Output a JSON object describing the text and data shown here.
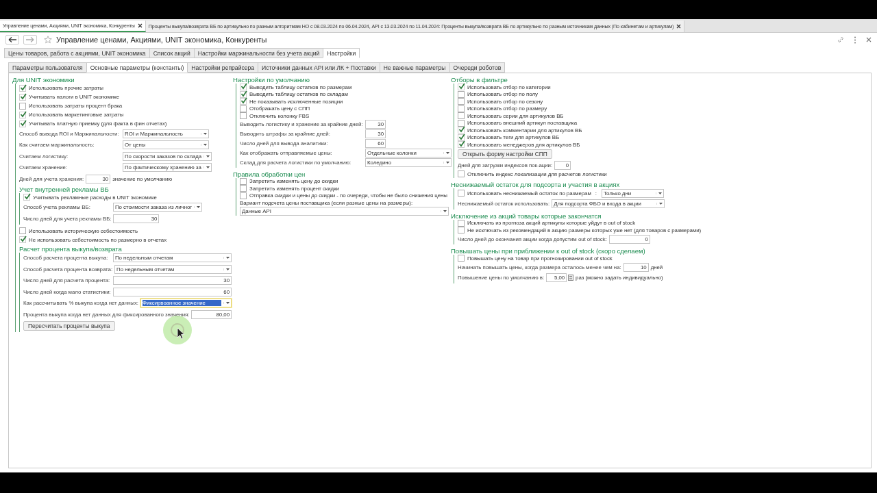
{
  "browser_tabs": [
    {
      "title": "Управление ценами, Акциями, UNIT экономика, Конкуренты",
      "selected": true
    },
    {
      "title": "Проценты выкупа/возврата ВБ по артикульно по разным алгоритмам НО с 08.03.2024 по 06.04.2024, API с 13.03.2024 по 11.04.2024: Проценты выкупа/возврата ВБ по артикульно по разным источникам данных (По кабинетам и артикулам)",
      "selected": false
    }
  ],
  "window": {
    "title": "Управление ценами, Акциями, UNIT экономика, Конкуренты"
  },
  "tabs": [
    {
      "label": "Цены товаров, работа с акциями, UNIT экономика",
      "selected": false
    },
    {
      "label": "Список акций",
      "selected": false
    },
    {
      "label": "Настройки маржинальности без учета акций",
      "selected": false
    },
    {
      "label": "Настройки",
      "selected": true
    }
  ],
  "subtabs": [
    {
      "label": "Параметры пользователя",
      "selected": false
    },
    {
      "label": "Основные параметры (константы)",
      "selected": true
    },
    {
      "label": "Настройки репрайсера",
      "selected": false
    },
    {
      "label": "Источники данных API или ЛК + Поставки",
      "selected": false
    },
    {
      "label": "Не важные параметры",
      "selected": false
    },
    {
      "label": "Очереди роботов",
      "selected": false
    }
  ],
  "columns": [
    {
      "sections": [
        {
          "title": "Для UNIT экономики",
          "items": [
            {
              "kind": "checkbox",
              "label": "Использовать прочие затраты",
              "checked": true
            },
            {
              "kind": "checkbox",
              "label": "Учитывать налоги в UNIT экономике",
              "checked": true
            },
            {
              "kind": "checkbox",
              "label": "Использовать затраты процент брака",
              "checked": false
            },
            {
              "kind": "checkbox",
              "label": "Использовать маркетинговые затраты",
              "checked": true
            },
            {
              "kind": "checkbox",
              "label": "Учитывать платную приемку (для факта в фин отчетах)",
              "checked": true
            },
            {
              "kind": "select",
              "label": "Способ вывода ROI и Маржинальности:",
              "value": "ROI и Маржинальность"
            },
            {
              "kind": "select",
              "label": "Как считаем маржинальность:",
              "value": "От цены"
            },
            {
              "kind": "select",
              "label": "Считаем логистику:",
              "value": "По скорости заказов по склада"
            },
            {
              "kind": "select",
              "label": "Считаем хранение:",
              "value": "По фактическому хранению за"
            },
            {
              "kind": "number",
              "label": "Дней для учета хранения:",
              "value": "30",
              "suffix": "значение по умолчанию"
            },
            {
              "kind": "group",
              "title": "Учет внутренней рекламы ВБ",
              "items": [
                {
                  "kind": "checkbox",
                  "label": "Учитывать рекламные расходы в UNIT экономике",
                  "checked": true
                },
                {
                  "kind": "select",
                  "label": "Способ учета рекламы ВБ:",
                  "value": "По стоимости заказа из личног"
                },
                {
                  "kind": "number",
                  "label": "Число дней для учета рекламы ВБ:",
                  "value": "30"
                }
              ]
            },
            {
              "kind": "checkbox",
              "label": "Использовать историческую себестоимость",
              "checked": false
            },
            {
              "kind": "checkbox",
              "label": "Не использовать себестоимость по размерно в отчетах",
              "checked": true
            },
            {
              "kind": "group",
              "title": "Расчет процента выкупа/возврата",
              "items": [
                {
                  "kind": "select",
                  "label": "Способ расчета процента выкупа:",
                  "value": "По недельным отчетам",
                  "focused": false
                },
                {
                  "kind": "select",
                  "label": "Способ расчета процента возврата:",
                  "value": "По недельным отчетам",
                  "focused": false
                },
                {
                  "kind": "number",
                  "label": "Число дней для расчета процента:",
                  "value": "30",
                  "focused": false
                },
                {
                  "kind": "number",
                  "label": "Число дней когда мало статистики:",
                  "value": "60",
                  "focused": false
                },
                {
                  "kind": "select",
                  "label": "Как рассчитывать % выкупа когда нет данных:",
                  "value": "Фиксирвоанное значение",
                  "focused": true
                },
                {
                  "kind": "number",
                  "label": "Процента выкупа когда нет данных для фиксированного значения:",
                  "value": "80,00",
                  "focused": false
                },
                {
                  "kind": "button",
                  "label": "Пересчитать проценты выкупа"
                }
              ]
            }
          ]
        }
      ]
    },
    {
      "sections": [
        {
          "title": "Настройки по умолчанию",
          "items": [
            {
              "kind": "checkbox",
              "label": "Выводить таблицу остатков по размерам",
              "checked": true
            },
            {
              "kind": "checkbox",
              "label": "Выводить таблицу остатков по складам",
              "checked": true
            },
            {
              "kind": "checkbox",
              "label": "Не показывать исключенные позиции",
              "checked": true
            },
            {
              "kind": "checkbox",
              "label": "Отображать цену с СПП",
              "checked": false
            },
            {
              "kind": "checkbox",
              "label": "Отключить колонку FBS",
              "checked": false
            },
            {
              "kind": "number",
              "label": "Выводить логистику и хранение за крайние дней:",
              "value": "30"
            },
            {
              "kind": "number",
              "label": "Выводить штрафы за крайние дней:",
              "value": "30"
            },
            {
              "kind": "number",
              "label": "Число дней для вывода аналитики:",
              "value": "60"
            },
            {
              "kind": "select",
              "label": "Как отображать отправляемые цены:",
              "value": "Отдельные колонки"
            },
            {
              "kind": "select",
              "label": "Склад для расчета логистики по умолчанию:",
              "value": "Коледино"
            }
          ]
        },
        {
          "title": "Правила обработки цен",
          "items": [
            {
              "kind": "checkbox",
              "label": "Запретить изменять цену до скидки",
              "checked": false
            },
            {
              "kind": "checkbox",
              "label": "Запретить изменять процент скидки",
              "checked": false
            },
            {
              "kind": "checkbox",
              "label": "Отправка скидки и цены до скидки - по очереди, чтобы не было снижения цены",
              "checked": false
            },
            {
              "kind": "stacked_select",
              "label": "Вариант подсчета цены поставщика (если разные цены на размеры):",
              "value": "Данные API"
            }
          ]
        }
      ]
    },
    {
      "sections": [
        {
          "title": "Отборы в фильтре",
          "items": [
            {
              "kind": "checkbox",
              "label": "Использовать отбор по категории",
              "checked": true
            },
            {
              "kind": "checkbox",
              "label": "Использовать отбор по полу",
              "checked": false
            },
            {
              "kind": "checkbox",
              "label": "Использовать отбор по сезону",
              "checked": false
            },
            {
              "kind": "checkbox",
              "label": "Использовать отбор по размеру",
              "checked": false
            },
            {
              "kind": "checkbox",
              "label": "Использовать серии для артикулов ВБ",
              "checked": false
            },
            {
              "kind": "checkbox",
              "label": "Использовать внешний артикул поставщика",
              "checked": false
            },
            {
              "kind": "checkbox",
              "label": "Использовать комментарии для артикулов ВБ",
              "checked": true
            },
            {
              "kind": "checkbox",
              "label": "Использовать теги для артикулов ВБ",
              "checked": true
            },
            {
              "kind": "checkbox",
              "label": "Использовать менеджеров для артикулов ВБ",
              "checked": true
            },
            {
              "kind": "button",
              "label": "Открыть форму настройки СПП"
            },
            {
              "kind": "number",
              "label": "Дней для загрузки индексов пок-ации:",
              "value": "0"
            },
            {
              "kind": "checkbox",
              "label": "Отключить индекс локализации для расчетов логистики",
              "checked": false
            }
          ]
        },
        {
          "title": "Неснижаемый остаток для подсорта и участия в акциях",
          "items": [
            {
              "kind": "checkbox_select",
              "label": "Использовать неснижаемый остаток по размерам",
              "separator": ":",
              "checked": false,
              "value": "Только дни"
            },
            {
              "kind": "select",
              "label": "Неснижаемый остаток использовать:",
              "value": "Для подсорта ФБО и входа в акции"
            }
          ]
        },
        {
          "title": "Исключение из акций товары которые закончатся",
          "items": [
            {
              "kind": "checkbox",
              "label": "Исключать из прогноза акций артикулы которые уйдут в out of stock",
              "checked": false
            },
            {
              "kind": "checkbox",
              "label": "Не исключать из рекомендаций в акцию размеры которых уже нет (для товаров с размерами)",
              "checked": false
            },
            {
              "kind": "number",
              "label": "Число дней до окончания акции когда допустим out of stock:",
              "value": "0"
            }
          ]
        },
        {
          "title": "Повышать цены при приближении к out of stock (скоро сделаем)",
          "items": [
            {
              "kind": "checkbox",
              "label": "Повышать цену на товар при прогнозировании out of stock",
              "checked": false
            },
            {
              "kind": "number",
              "label": "Начинать повышать цены, когда размера осталось менее чем на:",
              "value": "10",
              "suffix": "дней"
            },
            {
              "kind": "calc",
              "label": "Повышение цены по умолчанию в:",
              "value": "5,00",
              "suffix": "раз (можно задать индивидуально)"
            }
          ]
        }
      ]
    }
  ]
}
